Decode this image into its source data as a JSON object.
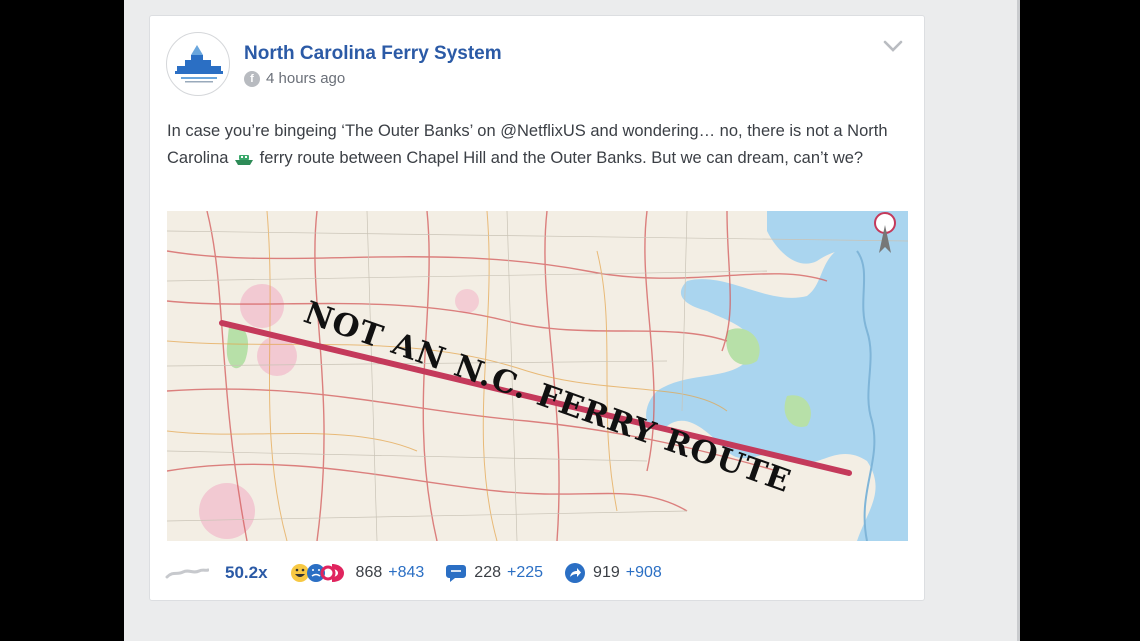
{
  "post": {
    "page_name": "North Carolina Ferry System",
    "timestamp": "4 hours ago",
    "text_part1": "In case you’re bingeing ‘The Outer Banks’ on @NetflixUS and wondering… no, there is not a North Carolina ",
    "text_part2": " ferry route between Chapel Hill and the Outer Banks. But we can dream, can’t we?",
    "map_overlay_text": "NOT AN N.C. FERRY ROUTE"
  },
  "stats": {
    "overperform": "50.2x",
    "reactions": "868",
    "reactions_delta": "+843",
    "comments": "228",
    "comments_delta": "+225",
    "shares": "919",
    "shares_delta": "+908"
  },
  "colors": {
    "brand_blue": "#2b5aa6",
    "route_line": "#c43a5b",
    "water": "#aad5ef"
  },
  "icons": [
    "facebook-icon",
    "chevron-down-icon",
    "trend-line-icon",
    "reaction-faces-icon",
    "comment-icon",
    "share-icon",
    "ferry-emoji-icon"
  ]
}
